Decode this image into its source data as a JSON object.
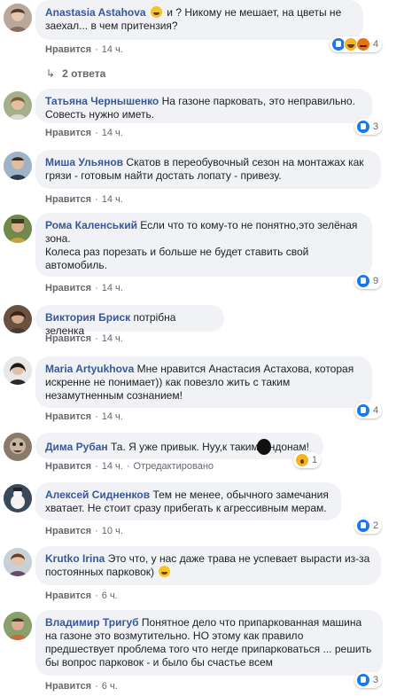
{
  "like_label": "Нравится",
  "replies_label": "2 ответа",
  "comments": [
    {
      "author": "Anastasia Astahova",
      "text": "и ? Никому не мешает, на цветы не заехал... в чем притензия?",
      "time": "14 ч.",
      "reactions": [
        "like",
        "haha",
        "angry"
      ],
      "count": "4",
      "edited": ""
    },
    {
      "author": "Татьяна Чернышенко",
      "text": "На газоне парковать, это неправильно. Совесть нужно иметь.",
      "time": "14 ч.",
      "reactions": [
        "like"
      ],
      "count": "3",
      "edited": ""
    },
    {
      "author": "Миша Ульянов",
      "text": "Скатов в переобувочный сезон на монтажах как грязи - готовым найти достать лопату - привезу.",
      "time": "14 ч.",
      "reactions": [],
      "count": "",
      "edited": ""
    },
    {
      "author": "Рома Каленський",
      "text": "Если что то кому-то не понятно,это зелёная зона.",
      "text2": "Колеса раз порезать и больше не будет ставить свой автомобиль.",
      "time": "14 ч.",
      "reactions": [
        "like"
      ],
      "count": "9",
      "edited": ""
    },
    {
      "author": "Виктория Бриск",
      "text": "потрібна зеленка",
      "time": "14 ч.",
      "reactions": [],
      "count": "",
      "edited": ""
    },
    {
      "author": "Maria Artyukhova",
      "text": "Мне нравится Анастасия Астахова, которая искренне не понимает)) как повезло жить с таким незамутненным сознанием!",
      "time": "14 ч.",
      "reactions": [
        "like"
      ],
      "count": "4",
      "edited": ""
    },
    {
      "author": "Дима Рубан",
      "text_a": "Та. Я уже привык. Нуу,к таким",
      "text_b": "ндонам!",
      "time": "14 ч.",
      "reactions": [
        "wow"
      ],
      "count": "1",
      "edited": "Отредактировано"
    },
    {
      "author": "Алексей Сидненков",
      "text": "Тем не менее, обычного замечания хватает. Не стоит сразу прибегать к агрессивным мерам.",
      "time": "10 ч.",
      "reactions": [
        "like"
      ],
      "count": "2",
      "edited": ""
    },
    {
      "author": "Krutko Irina",
      "text": "Это что, у нас даже трава не успевает вырасти из-за постоянных парковок)",
      "time": "6 ч.",
      "reactions": [],
      "count": "",
      "edited": ""
    },
    {
      "author": "Владимир Тригуб",
      "text": "Понятное дело что припаркованная машина на газоне это возмутительно. НО этому как правило предшествует проблема того что негде припарковаться ... решить бы вопрос парковок - и было бы счастье всем",
      "time": "6 ч.",
      "reactions": [
        "like"
      ],
      "count": "3",
      "edited": ""
    }
  ],
  "colors": {
    "author": "#385898",
    "bubble": "#f0f2f5",
    "meta": "#65676b",
    "like": "#1877f2"
  }
}
